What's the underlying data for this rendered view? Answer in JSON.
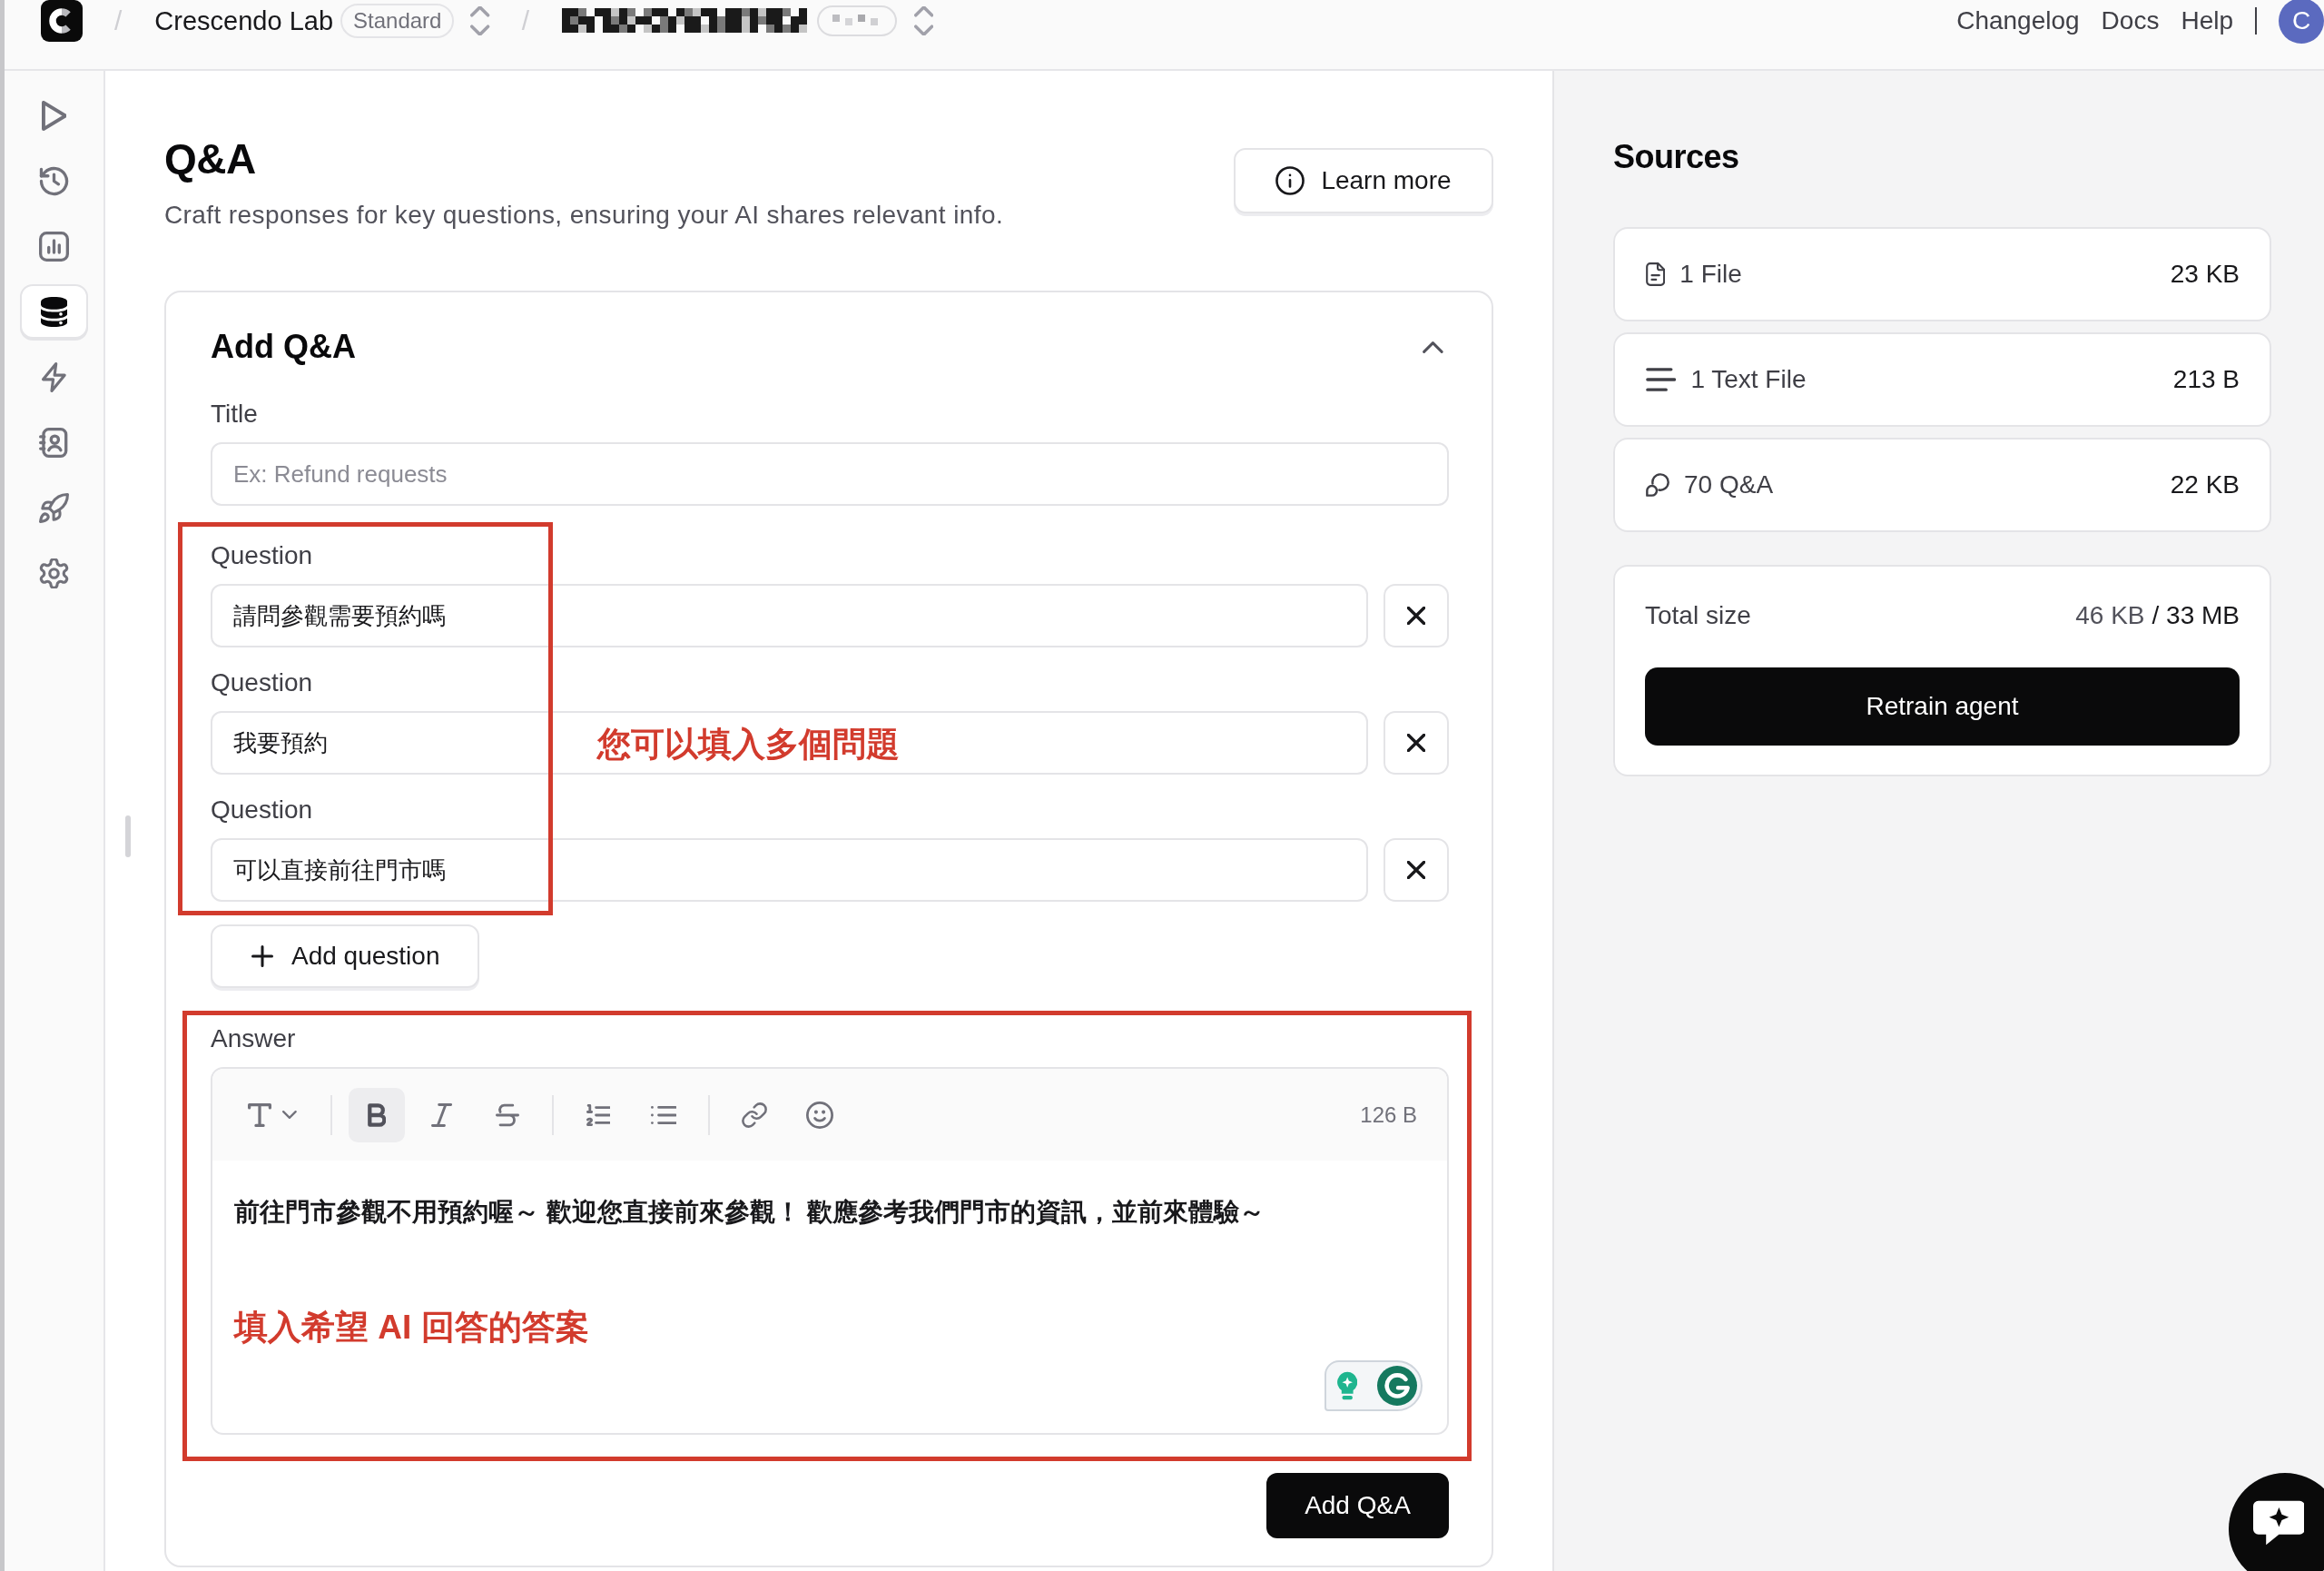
{
  "topbar": {
    "breadcrumb": [
      {
        "kind": "workspace",
        "separator": "/",
        "label": "Crescendo Lab",
        "badge": "Standard"
      },
      {
        "kind": "redacted",
        "separator": "/"
      }
    ],
    "links": [
      "Changelog",
      "Docs",
      "Help"
    ],
    "avatar": "C"
  },
  "sidebar": {
    "items": [
      {
        "selected": false
      },
      {
        "selected": false
      },
      {
        "selected": false
      },
      {
        "selected": true
      },
      {
        "selected": false
      },
      {
        "selected": false
      },
      {
        "selected": false
      },
      {
        "selected": false
      }
    ]
  },
  "page": {
    "title": "Q&A",
    "subtitle": "Craft responses for key questions, ensuring your AI shares relevant info.",
    "learn_more": "Learn more"
  },
  "form": {
    "heading": "Add Q&A",
    "expanded": true,
    "title_field": {
      "label": "Title",
      "placeholder": "Ex: Refund requests"
    },
    "questions": {
      "items": [
        {
          "label": "Question",
          "value": "請問參觀需要預約嗎"
        },
        {
          "label": "Question",
          "value": "我要預約"
        },
        {
          "label": "Question",
          "value": "可以直接前往門市嗎"
        }
      ],
      "annotation": "您可以填入多個問題",
      "add_button": "Add question"
    },
    "answer": {
      "label": "Answer",
      "toolbar": {
        "groups": [
          [
            {
              "on": false
            }
          ],
          [
            {
              "on": true
            },
            {
              "on": false
            },
            {
              "on": false
            }
          ],
          [
            {
              "on": false
            },
            {
              "on": false
            }
          ],
          [
            {
              "on": false
            },
            {
              "on": false
            }
          ]
        ]
      },
      "size": "126 B",
      "text": "前往門市參觀不用預約喔～ 歡迎您直接前來參觀！ 歡應參考我們門市的資訊，並前來體驗～",
      "annotation": "填入希望 AI 回答的答案"
    },
    "submit": "Add Q&A"
  },
  "sources": {
    "title": "Sources",
    "items": [
      {
        "kind": "file",
        "label": "1 File",
        "size": "23 KB"
      },
      {
        "kind": "text",
        "label": "1 Text File",
        "size": "213 B"
      },
      {
        "kind": "qa",
        "label": "70 Q&A",
        "size": "22 KB"
      }
    ],
    "total": {
      "label": "Total size",
      "used": "46 KB",
      "limit": "/ 33 MB"
    },
    "retrain": "Retrain agent"
  }
}
